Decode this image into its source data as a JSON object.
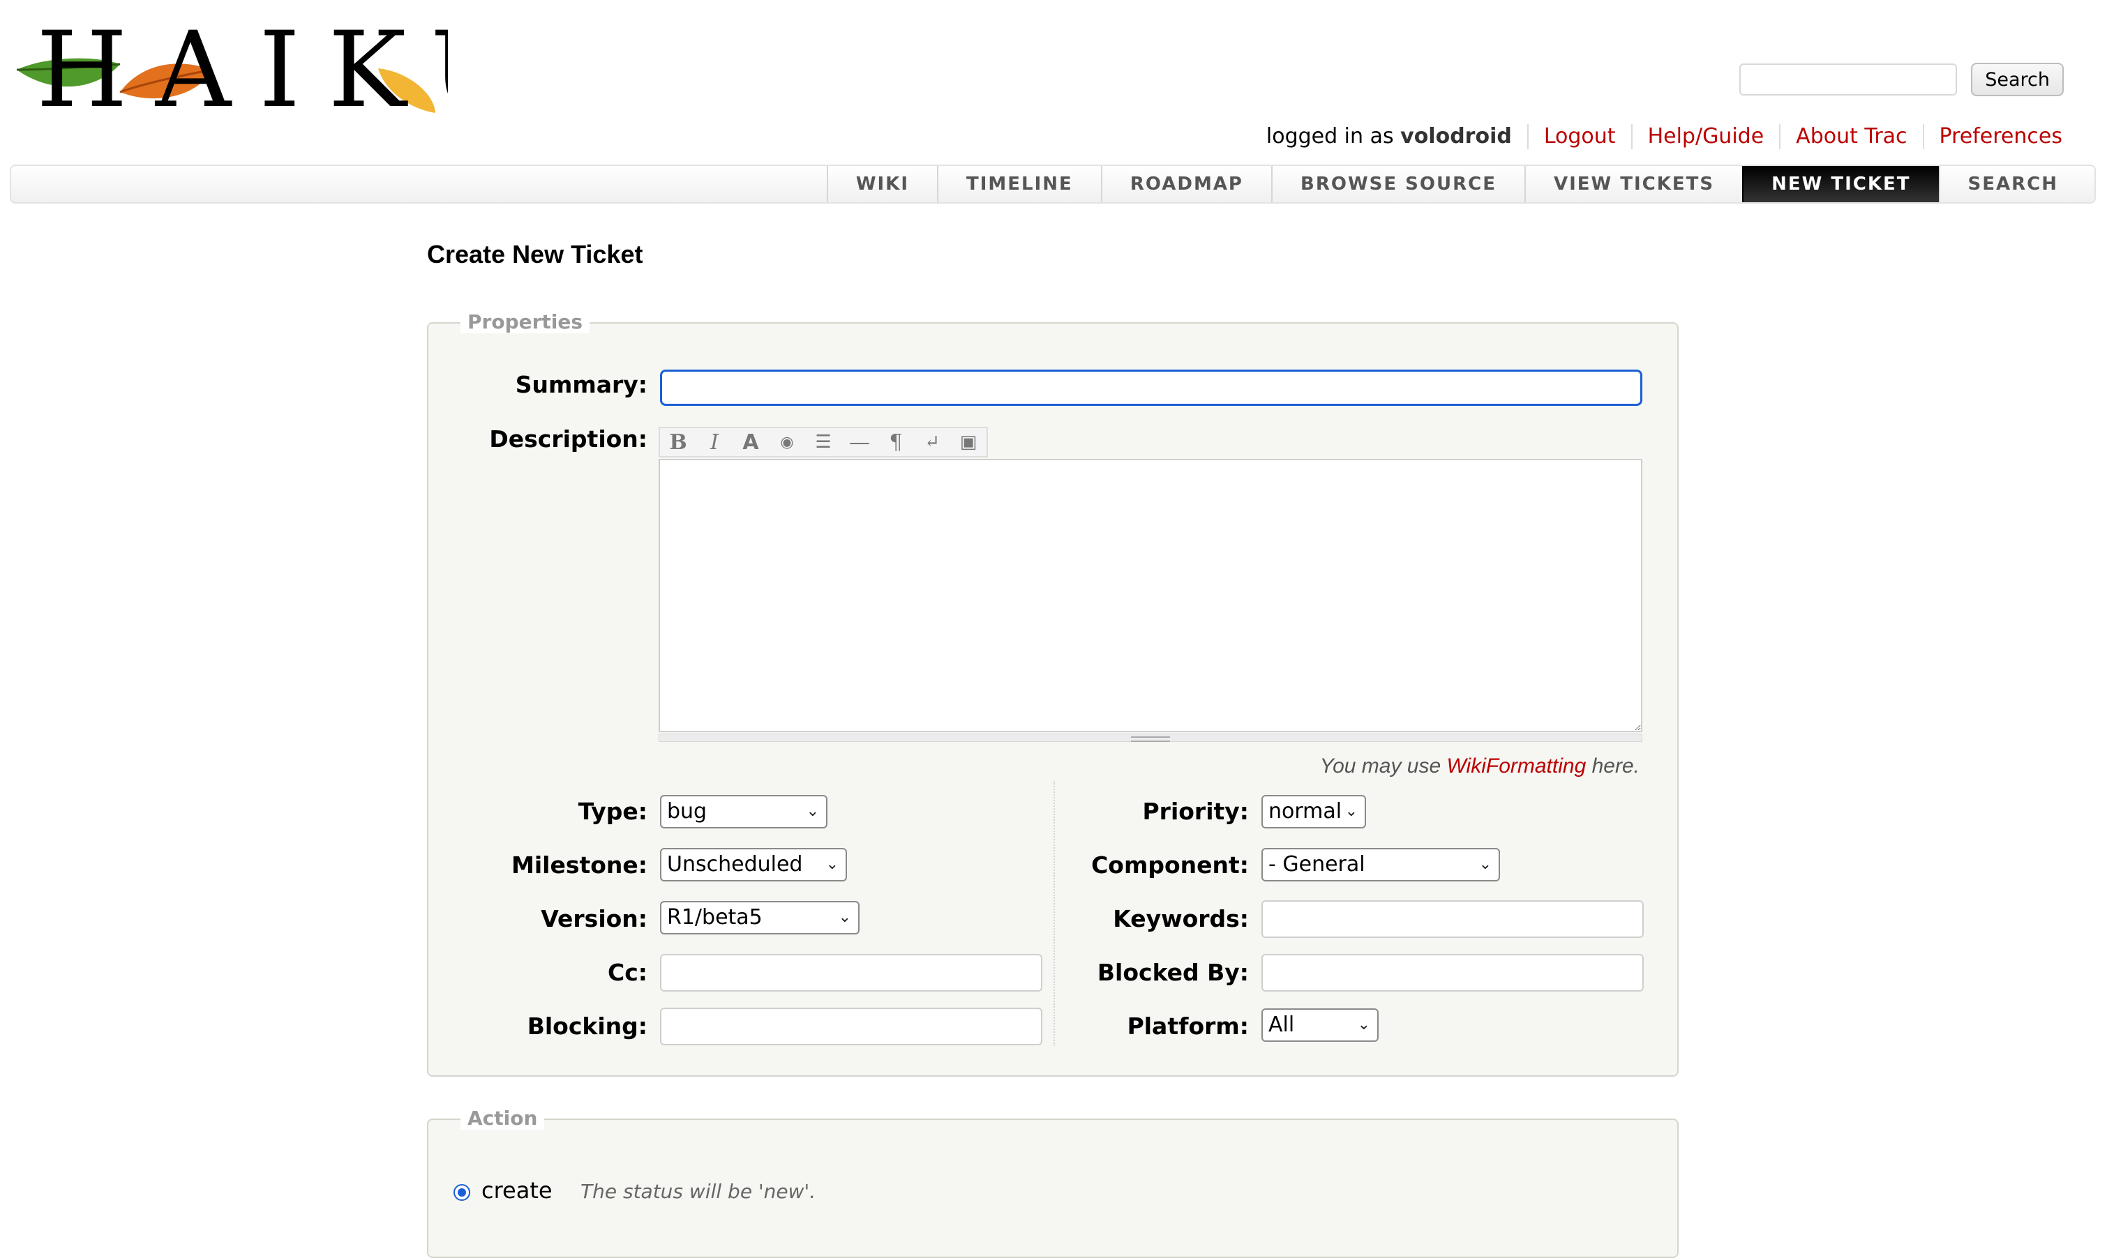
{
  "header": {
    "logo_text": "HAIKU",
    "search": {
      "value": "",
      "button_label": "Search"
    },
    "metanav": {
      "logged_in_prefix": "logged in as",
      "username": "volodroid",
      "links": [
        "Logout",
        "Help/Guide",
        "About Trac",
        "Preferences"
      ]
    },
    "mainnav": [
      "WIKI",
      "TIMELINE",
      "ROADMAP",
      "BROWSE SOURCE",
      "VIEW TICKETS",
      "NEW TICKET",
      "SEARCH"
    ],
    "active_tab": "NEW TICKET"
  },
  "page": {
    "title": "Create New Ticket",
    "properties_legend": "Properties",
    "action_legend": "Action"
  },
  "form": {
    "labels": {
      "summary": "Summary:",
      "description": "Description:",
      "type": "Type:",
      "milestone": "Milestone:",
      "version": "Version:",
      "cc": "Cc:",
      "blocking": "Blocking:",
      "priority": "Priority:",
      "component": "Component:",
      "keywords": "Keywords:",
      "blocked_by": "Blocked By:",
      "platform": "Platform:"
    },
    "values": {
      "summary": "",
      "description": "",
      "type": "bug",
      "milestone": "Unscheduled",
      "version": "R1/beta5",
      "cc": "",
      "blocking": "",
      "priority": "normal",
      "component": "- General",
      "keywords": "",
      "blocked_by": "",
      "platform": "All"
    },
    "toolbar": [
      "bold-icon",
      "italic-icon",
      "heading-icon",
      "link-icon",
      "code-block-icon",
      "horizontal-rule-icon",
      "paragraph-icon",
      "line-break-icon",
      "image-icon"
    ],
    "hint": {
      "prefix": "You may use",
      "link": "WikiFormatting",
      "suffix": "here."
    }
  },
  "action": {
    "option_label": "create",
    "option_hint": "The status will be 'new'."
  },
  "colors": {
    "link": "#bb0000",
    "focus": "#1a5fd6",
    "active_tab_bg": "#000000",
    "fieldset_bg": "#f6f6f2"
  }
}
